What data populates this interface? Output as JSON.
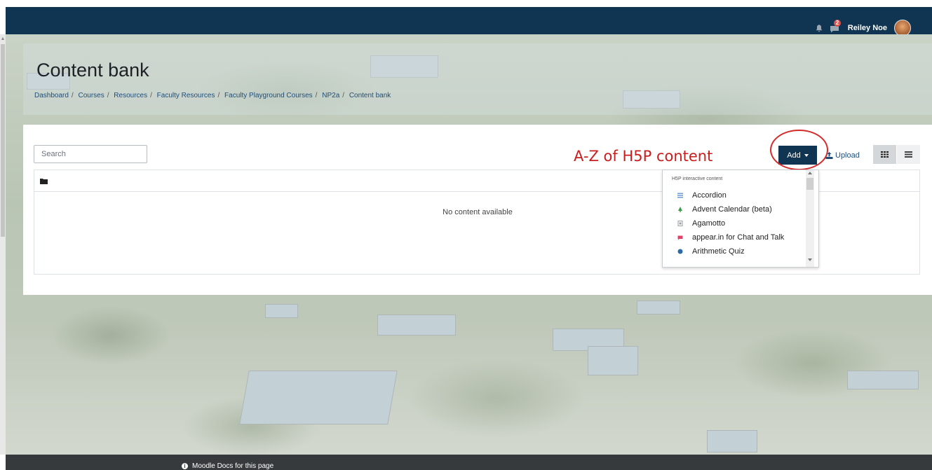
{
  "navbar": {
    "user_name": "Reiley Noe",
    "message_count": "2"
  },
  "page": {
    "title": "Content bank",
    "breadcrumb": [
      "Dashboard",
      "Courses",
      "Resources",
      "Faculty Resources",
      "Faculty Playground Courses",
      "NP2a",
      "Content bank"
    ]
  },
  "toolbar": {
    "search_placeholder": "Search",
    "add_label": "Add",
    "upload_label": "Upload"
  },
  "annotation": "A-Z of H5P content",
  "files": {
    "empty_message": "No content available"
  },
  "dropdown": {
    "header": "H5P interactive content",
    "items": [
      {
        "label": "Accordion",
        "icon": "accordion-icon",
        "color": "#6b9ad6"
      },
      {
        "label": "Advent Calendar (beta)",
        "icon": "tree-icon",
        "color": "#3d9a4a"
      },
      {
        "label": "Agamotto",
        "icon": "agamotto-icon",
        "color": "#9aa0a6"
      },
      {
        "label": "appear.in for Chat and Talk",
        "icon": "appear-icon",
        "color": "#e0436a"
      },
      {
        "label": "Arithmetic Quiz",
        "icon": "arithmetic-icon",
        "color": "#2c6aa6"
      }
    ]
  },
  "footer": {
    "docs_link": "Moodle Docs for this page"
  },
  "colors": {
    "brand": "#0f3552",
    "annotation": "#c81e1e"
  }
}
